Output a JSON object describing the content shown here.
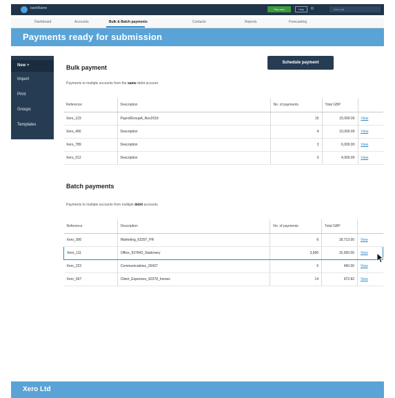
{
  "topbar": {
    "brand": "bankName",
    "primary_button": "Pay now",
    "help_button": "Help",
    "gear_icon": "gear-icon",
    "org_label": "Xero Ltd"
  },
  "nav": {
    "items": [
      "Dashboard",
      "Accounts",
      "Bulk & Batch payments",
      "Contacts",
      "Reports",
      "Forecasting"
    ],
    "active_index": 2
  },
  "header": {
    "title": "Payments ready for submission"
  },
  "sidebar": {
    "items": [
      "New +",
      "Import",
      "Print",
      "Groups",
      "Templates"
    ]
  },
  "actions": {
    "schedule": "Schedule payment"
  },
  "bulk": {
    "title": "Bulk payment",
    "desc_pre": "Payments to multiple accounts from the ",
    "desc_bold": "same",
    "desc_post": " debit account.",
    "columns": [
      "Reference",
      "Description",
      "No. of payments",
      "Total GBP",
      ""
    ],
    "rows": [
      {
        "ref": "Xero_123",
        "desc": "PayrollGroupA_Nov2018",
        "count": "15",
        "total": "15,000.00",
        "action": "View"
      },
      {
        "ref": "Xero_456",
        "desc": "Description",
        "count": "4",
        "total": "10,000.00",
        "action": "View"
      },
      {
        "ref": "Xero_789",
        "desc": "Description",
        "count": "3",
        "total": "6,000.00",
        "action": "View"
      },
      {
        "ref": "Xero_012",
        "desc": "Description",
        "count": "3",
        "total": "4,000.00",
        "action": "View"
      }
    ]
  },
  "batch": {
    "title": "Batch payments",
    "desc_pre": "Payments to multiple accounts from multiple ",
    "desc_bold": "debit",
    "desc_post": " accounts.",
    "columns": [
      "Reference",
      "Description",
      "No. of payments",
      "Total GBP",
      ""
    ],
    "rows": [
      {
        "ref": "Xero_000",
        "desc": "Marketing_63297_PR",
        "count": "6",
        "total": "18,713.00",
        "action": "View"
      },
      {
        "ref": "Xero_111",
        "desc": "Office_937843_Stationery",
        "count": "3,995",
        "total": "15,000.00",
        "action": "View"
      },
      {
        "ref": "Xero_222",
        "desc": "Communications_26437",
        "count": "6",
        "total": "450.00",
        "action": "View"
      },
      {
        "ref": "Xero_567",
        "desc": "Client_Expenses_92378_horses",
        "count": "14",
        "total": "972.82",
        "action": "View"
      }
    ],
    "highlight_index": 1
  },
  "footer": {
    "org": "Xero Ltd"
  },
  "colors": {
    "topbar": "#1f3448",
    "accent": "#5aa3d6",
    "sidebar": "#263c52",
    "link": "#2b86c5",
    "green": "#3c9a3a"
  }
}
